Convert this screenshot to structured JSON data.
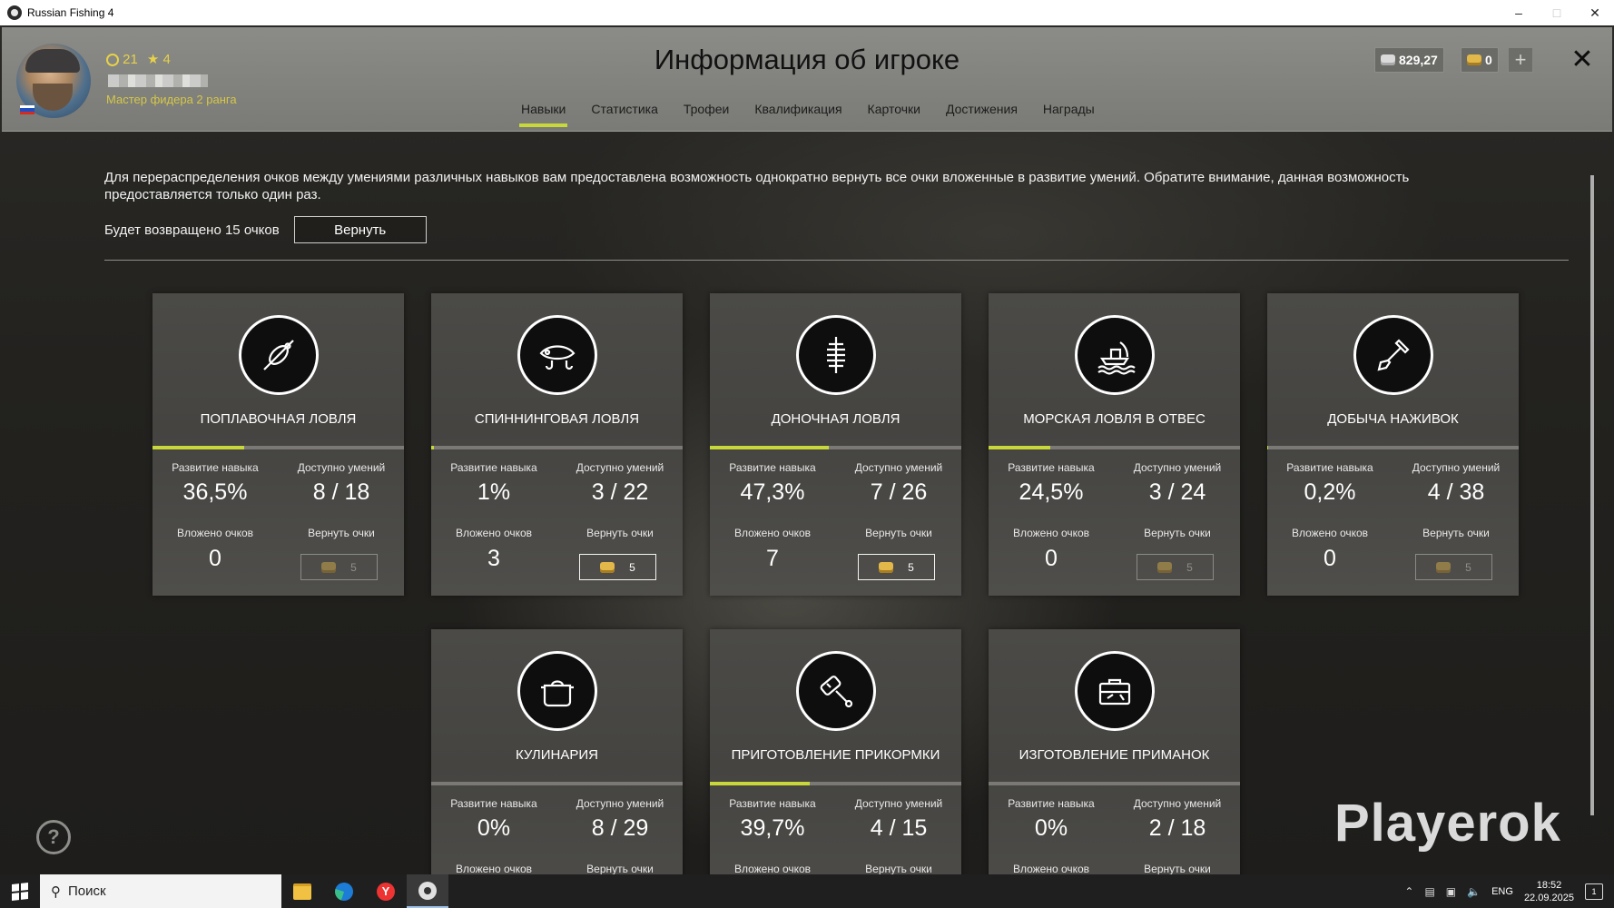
{
  "window": {
    "title": "Russian Fishing 4"
  },
  "header": {
    "level": "21",
    "stars": "4",
    "rank": "Мастер фидера 2 ранга",
    "title": "Информация об игроке",
    "silver": "829,27",
    "gold": "0",
    "tabs": [
      "Навыки",
      "Статистика",
      "Трофеи",
      "Квалификация",
      "Карточки",
      "Достижения",
      "Награды"
    ],
    "active_tab": "Навыки"
  },
  "notice": {
    "text": "Для перераспределения очков между умениями различных навыков вам предоставлена возможность однократно вернуть все очки вложенные в развитие умений. Обратите внимание, данная возможность предоставляется только один раз.",
    "refund_text": "Будет возвращено 15 очков",
    "refund_button": "Вернуть"
  },
  "labels": {
    "development": "Развитие навыка",
    "available": "Доступно умений",
    "invested": "Вложено очков",
    "return": "Вернуть очки",
    "invested_cut": "Вложено очков",
    "return_cut": "Вернуть очки"
  },
  "skills": [
    {
      "name": "ПОПЛАВОЧНАЯ ЛОВЛЯ",
      "icon": "float-icon",
      "development": "36,5%",
      "progress": 0.365,
      "available": "8 / 18",
      "invested": "0",
      "return_cost": "5",
      "return_enabled": false
    },
    {
      "name": "СПИННИНГОВАЯ ЛОВЛЯ",
      "icon": "lure-icon",
      "development": "1%",
      "progress": 0.01,
      "available": "3 / 22",
      "invested": "3",
      "return_cost": "5",
      "return_enabled": true
    },
    {
      "name": "ДОНОЧНАЯ ЛОВЛЯ",
      "icon": "feeder-icon",
      "development": "47,3%",
      "progress": 0.473,
      "available": "7 / 26",
      "invested": "7",
      "return_cost": "5",
      "return_enabled": true
    },
    {
      "name": "МОРСКАЯ ЛОВЛЯ В ОТВЕС",
      "icon": "boat-icon",
      "development": "24,5%",
      "progress": 0.245,
      "available": "3 / 24",
      "invested": "0",
      "return_cost": "5",
      "return_enabled": false
    },
    {
      "name": "ДОБЫЧА НАЖИВОК",
      "icon": "shovel-icon",
      "development": "0,2%",
      "progress": 0.002,
      "available": "4 / 38",
      "invested": "0",
      "return_cost": "5",
      "return_enabled": false
    },
    {
      "name": "КУЛИНАРИЯ",
      "icon": "pot-icon",
      "development": "0%",
      "progress": 0.0,
      "available": "8 / 29"
    },
    {
      "name": "ПРИГОТОВЛЕНИЕ ПРИКОРМКИ",
      "icon": "mixer-icon",
      "development": "39,7%",
      "progress": 0.397,
      "available": "4 / 15"
    },
    {
      "name": "ИЗГОТОВЛЕНИЕ ПРИМАНОК",
      "icon": "toolbox-icon",
      "development": "0%",
      "progress": 0.0,
      "available": "2 / 18"
    }
  ],
  "watermark": "Playerok",
  "taskbar": {
    "search_placeholder": "Поиск",
    "language": "ENG",
    "time": "18:52",
    "date": "22.09.2025",
    "notifications": "1"
  },
  "colors": {
    "accent": "#c8d83a",
    "currency_text": "#e6d24a"
  }
}
